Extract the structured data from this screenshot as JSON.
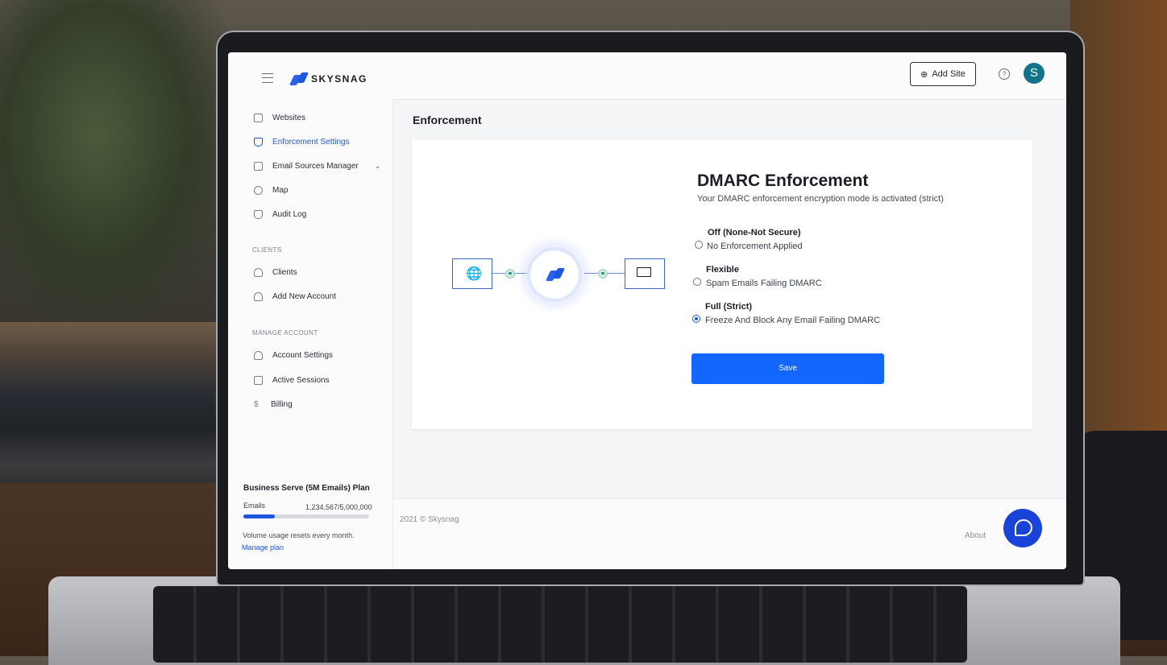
{
  "header": {
    "brand": "SKYSNAG",
    "add_site_label": "Add Site",
    "avatar_initial": "S"
  },
  "sidebar": {
    "items": [
      {
        "label": "Websites"
      },
      {
        "label": "Enforcement Settings",
        "active": true
      },
      {
        "label": "Email Sources Manager"
      },
      {
        "label": "Map"
      },
      {
        "label": "Audit Log"
      }
    ],
    "clients_section": "CLIENTS",
    "clients_items": [
      {
        "label": "Clients"
      },
      {
        "label": "Add New Account"
      }
    ],
    "manage_section": "MANAGE ACCOUNT",
    "manage_items": [
      {
        "label": "Account Settings"
      },
      {
        "label": "Active Sessions"
      },
      {
        "label": "Billing"
      }
    ],
    "plan": {
      "title": "Business Serve (5M Emails) Plan",
      "emails_label": "Emails",
      "emails_count": "1,234,567/5,000,000",
      "usage_fraction": 0.25,
      "reset_note": "Volume usage resets every month.",
      "manage_link": "Manage plan"
    }
  },
  "main": {
    "page_title": "Enforcement",
    "dmarc_title": "DMARC Enforcement",
    "dmarc_subtitle": "Your DMARC enforcement encryption mode is activated (strict)",
    "options": [
      {
        "title": "Off (None-Not Secure)",
        "desc": "No Enforcement Applied",
        "selected": false
      },
      {
        "title": "Flexible",
        "desc": "Spam Emails Failing DMARC",
        "selected": false
      },
      {
        "title": "Full (Strict)",
        "desc": "Freeze And Block Any Email Failing DMARC",
        "selected": true
      }
    ],
    "save_label": "Save"
  },
  "footer": {
    "copyright": "2021 © Skysnag",
    "about": "About"
  },
  "colors": {
    "accent": "#1d57e0",
    "save_button": "#1367ff",
    "avatar": "#12738a",
    "chat": "#1a44d8"
  }
}
